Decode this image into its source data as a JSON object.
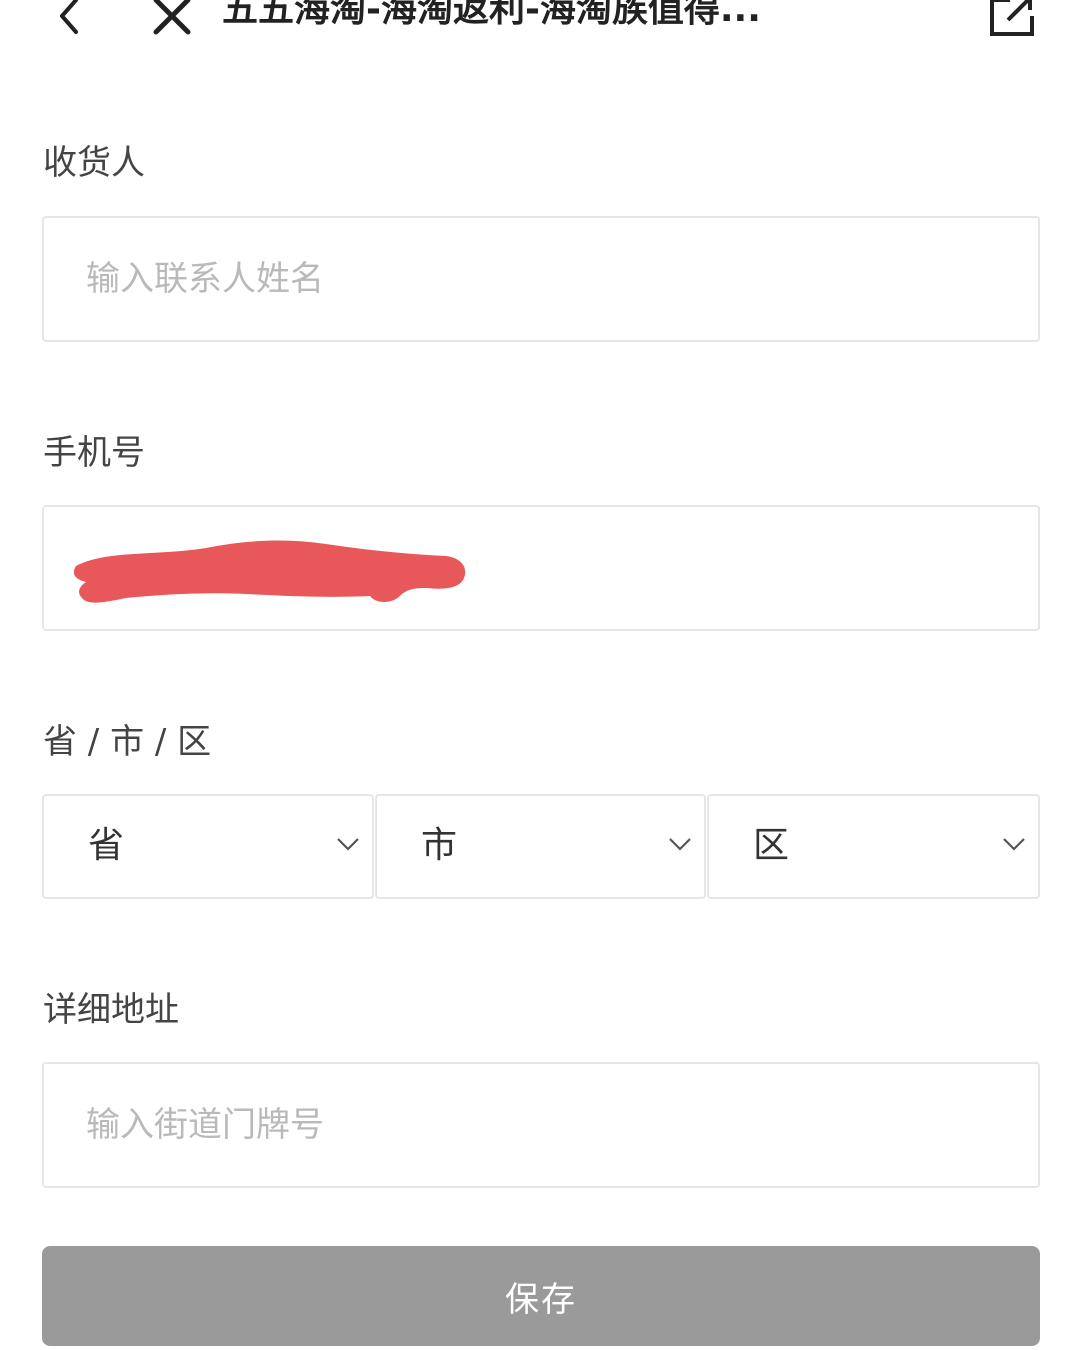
{
  "header": {
    "title": "五五海淘-海淘返利-海淘族值得...",
    "back_icon": "chevron-left-icon",
    "close_icon": "close-icon",
    "share_icon": "external-link-icon"
  },
  "form": {
    "recipient": {
      "label": "收货人",
      "value": "",
      "placeholder": "输入联系人姓名"
    },
    "phone": {
      "label": "手机号",
      "value": "",
      "redaction_color": "#e8585b"
    },
    "region": {
      "label": "省 / 市 / 区",
      "province": "省",
      "city": "市",
      "district": "区",
      "chevron_icon": "chevron-down-icon"
    },
    "address": {
      "label": "详细地址",
      "value": "",
      "placeholder": "输入街道门牌号"
    },
    "save_label": "保存"
  },
  "colors": {
    "border": "#e6e6e6",
    "placeholder": "#b9b9b9",
    "label": "#444444",
    "button_bg": "#9a9a9a",
    "button_text": "#ffffff"
  }
}
